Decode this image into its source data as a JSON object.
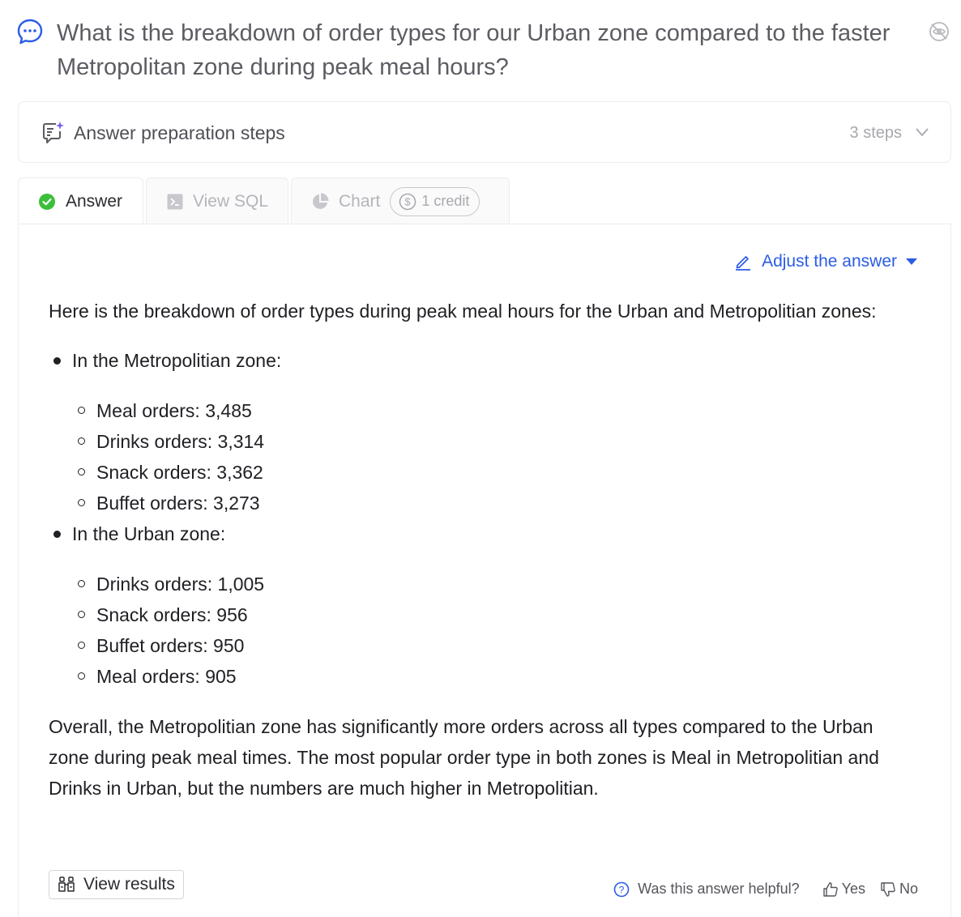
{
  "question": {
    "text": "What is the breakdown of order types for our Urban zone compared to the faster Metropolitan zone during peak meal hours?"
  },
  "steps": {
    "label": "Answer preparation steps",
    "count": "3 steps"
  },
  "tabs": [
    {
      "label": "Answer",
      "icon": "check-circle-icon"
    },
    {
      "label": "View SQL",
      "icon": "terminal-icon"
    },
    {
      "label": "Chart",
      "icon": "pie-chart-icon",
      "badge": "1 credit"
    }
  ],
  "adjust": {
    "label": "Adjust the answer"
  },
  "answer": {
    "intro": "Here is the breakdown of order types during peak meal hours for the Urban and Metropolitian zones:",
    "zones": [
      {
        "label": "In the Metropolitian zone:",
        "items": [
          "Meal orders: 3,485",
          "Drinks orders: 3,314",
          "Snack orders: 3,362",
          "Buffet orders: 3,273"
        ]
      },
      {
        "label": "In the Urban zone:",
        "items": [
          "Drinks orders: 1,005",
          "Snack orders: 956",
          "Buffet orders: 950",
          "Meal orders: 905"
        ]
      }
    ],
    "summary": "Overall, the Metropolitian zone has significantly more orders across all types compared to the Urban zone during peak meal times. The most popular order type in both zones is Meal in Metropolitian and Drinks in Urban, but the numbers are much higher in Metropolitian."
  },
  "footer": {
    "view_results": "View results",
    "helpful_question": "Was this answer helpful?",
    "yes": "Yes",
    "no": "No"
  },
  "colors": {
    "accent": "#2b5ce6",
    "success": "#3bbf3b",
    "brand_purple": "#7b5cf0"
  }
}
